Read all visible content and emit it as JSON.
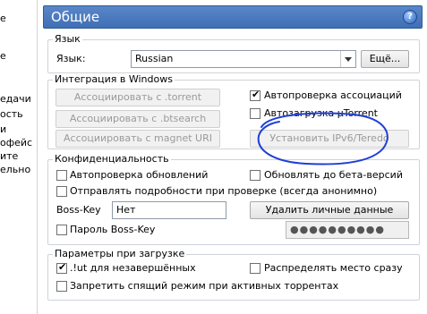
{
  "left_tree": [
    "е",
    "",
    "е",
    "",
    "едачи",
    "ость",
    "и",
    "офейс",
    "ите",
    "ельно"
  ],
  "header": {
    "title": "Общие",
    "help_icon": "?"
  },
  "language": {
    "group_title": "Язык",
    "label": "Язык:",
    "selected": "Russian",
    "more_button": "Ещё..."
  },
  "windows": {
    "group_title": "Интеграция в Windows",
    "assoc_torrent": "Ассоциировать с .torrent",
    "assoc_btsearch": "Ассоциировать с .btsearch",
    "assoc_magnet": "Ассоциировать с magnet URI",
    "check_assoc": {
      "label": "Автопроверка ассоциаций",
      "checked": true
    },
    "autostart": {
      "label": "Автозагрузка µTorrent",
      "checked": false
    },
    "ipv6_button": "Установить IPv6/Teredo"
  },
  "privacy": {
    "group_title": "Конфиденциальность",
    "auto_update": {
      "label": "Автопроверка обновлений",
      "checked": false
    },
    "beta": {
      "label": "Обновлять до бета-версий",
      "checked": false
    },
    "send_details": {
      "label": "Отправлять подробности при проверке (всегда анонимно)",
      "checked": false
    },
    "boss_key_label": "Boss-Key",
    "boss_key_value": "Нет",
    "delete_data_button": "Удалить личные данные",
    "boss_pass": {
      "label": "Пароль Boss-Key",
      "checked": false
    },
    "password_mask": "●●●●●●●●●●"
  },
  "startup": {
    "group_title": "Параметры при загрузке",
    "ut_ext": {
      "label": ".!ut для незавершённых",
      "checked": true
    },
    "prealloc": {
      "label": "Распределять место сразу",
      "checked": false
    },
    "no_sleep": {
      "label": "Запретить спящий режим при активных торрентах",
      "checked": false
    }
  },
  "colors": {
    "header": "#4a7cc1",
    "annotation": "#1f3fd6"
  }
}
